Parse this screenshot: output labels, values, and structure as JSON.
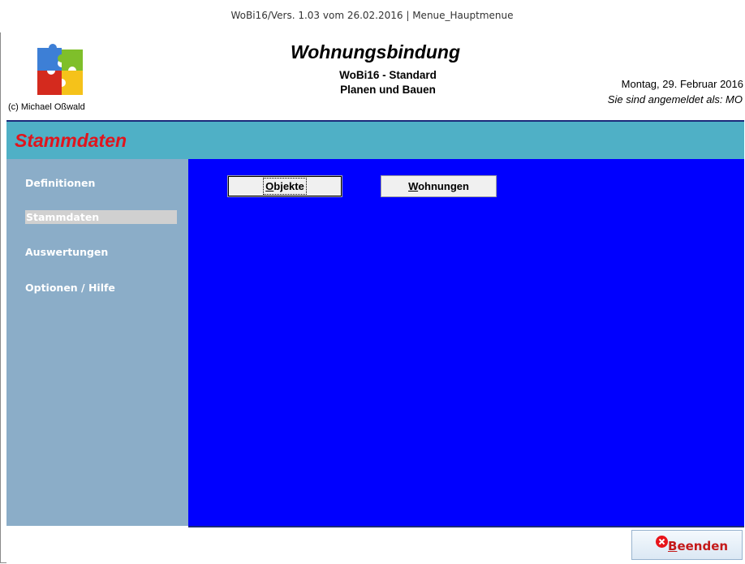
{
  "window": {
    "title": "WoBi16/Vers. 1.03 vom 26.02.2016 | Menue_Hauptmenue"
  },
  "header": {
    "copyright": "(c) Michael Oßwald",
    "app_title": "Wohnungsbindung",
    "subtitle1": "WoBi16 - Standard",
    "subtitle2": "Planen und Bauen",
    "date": "Montag, 29. Februar 2016",
    "login": "Sie sind angemeldet als: MO"
  },
  "section": {
    "title": "Stammdaten"
  },
  "sidebar": {
    "items": [
      {
        "label": "Definitionen",
        "active": false
      },
      {
        "label": "Stammdaten",
        "active": true
      },
      {
        "label": "Auswertungen",
        "active": false
      },
      {
        "label": "Optionen / Hilfe",
        "active": false
      }
    ]
  },
  "main": {
    "buttons": [
      {
        "accel": "O",
        "rest": "bjekte",
        "focused": true
      },
      {
        "accel": "W",
        "rest": "ohnungen",
        "focused": false
      }
    ]
  },
  "footer": {
    "quit_accel": "B",
    "quit_rest": "eenden"
  },
  "colors": {
    "section_bar": "#4fb0c6",
    "section_title": "#e0151d",
    "sidebar": "#8badc8",
    "main": "#0000ff",
    "accent_line": "#1c2a7a"
  }
}
